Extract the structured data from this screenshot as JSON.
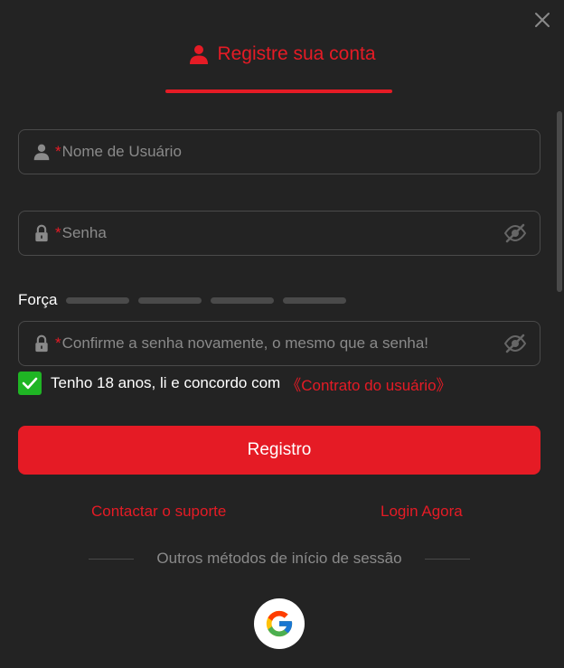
{
  "header": {
    "title": "Registre sua conta"
  },
  "form": {
    "username": {
      "required_mark": "*",
      "placeholder": "Nome de Usuário",
      "value": ""
    },
    "password": {
      "required_mark": "*",
      "placeholder": "Senha",
      "value": ""
    },
    "strength": {
      "label": "Força",
      "segments_filled": 0,
      "segments_total": 4
    },
    "confirm": {
      "required_mark": "*",
      "placeholder": "Confirme a senha novamente, o mesmo que a senha!",
      "value": ""
    },
    "agree": {
      "checked": true,
      "text": "Tenho 18 anos, li e concordo com",
      "link": "《Contrato do usuário》"
    },
    "submit_label": "Registro"
  },
  "links": {
    "support": "Contactar o suporte",
    "login": "Login Agora"
  },
  "other_methods": {
    "label": "Outros métodos de início de sessão"
  },
  "colors": {
    "accent": "#e51b25",
    "background": "#232323",
    "border": "#4a4a4a",
    "check": "#1fb524",
    "muted": "#8a8a8a"
  },
  "icons": {
    "close": "close-icon",
    "user": "user-icon",
    "lock": "lock-icon",
    "eye": "eye-off-icon",
    "check": "check-icon",
    "google": "google-icon"
  }
}
